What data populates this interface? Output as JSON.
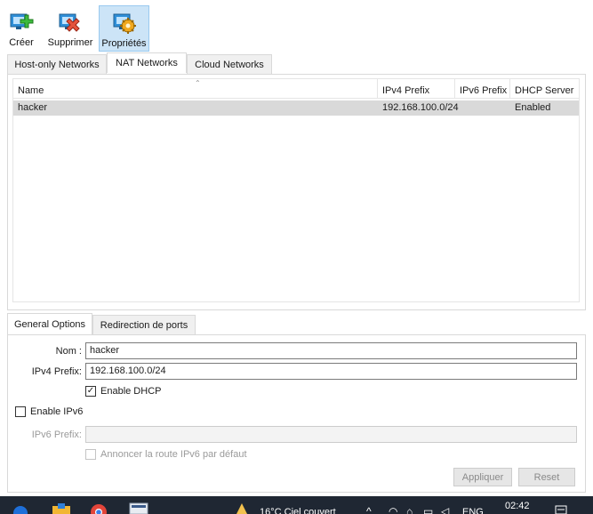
{
  "toolbar": {
    "create_label": "Créer",
    "delete_label": "Supprimer",
    "properties_label": "Propriétés"
  },
  "top_tabs": [
    "Host-only Networks",
    "NAT Networks",
    "Cloud Networks"
  ],
  "active_top_tab": "NAT Networks",
  "table": {
    "columns": [
      "Name",
      "IPv4 Prefix",
      "IPv6 Prefix",
      "DHCP Server"
    ],
    "rows": [
      {
        "name": "hacker",
        "ipv4": "192.168.100.0/24",
        "ipv6": "",
        "dhcp": "Enabled"
      }
    ]
  },
  "bottom_tabs": [
    "General Options",
    "Redirection de ports"
  ],
  "active_bottom_tab": "General Options",
  "form": {
    "name_label": "Nom :",
    "name_value": "hacker",
    "ipv4_label": "IPv4 Prefix:",
    "ipv4_value": "192.168.100.0/24",
    "enable_dhcp_label": "Enable DHCP",
    "enable_dhcp_checked": true,
    "enable_ipv6_label": "Enable IPv6",
    "enable_ipv6_checked": false,
    "ipv6_label": "IPv6 Prefix:",
    "ipv6_value": "",
    "announce_label": "Annoncer la route IPv6 par défaut",
    "announce_checked": false
  },
  "buttons": {
    "apply_label": "Appliquer",
    "reset_label": "Reset"
  },
  "taskbar": {
    "weather_text": "16°C  Ciel couvert",
    "language": "ENG",
    "time": "02:42"
  },
  "colors": {
    "selection": "#d9d9d9",
    "active_tool": "#cce4f7",
    "taskbar": "#1f2733"
  }
}
